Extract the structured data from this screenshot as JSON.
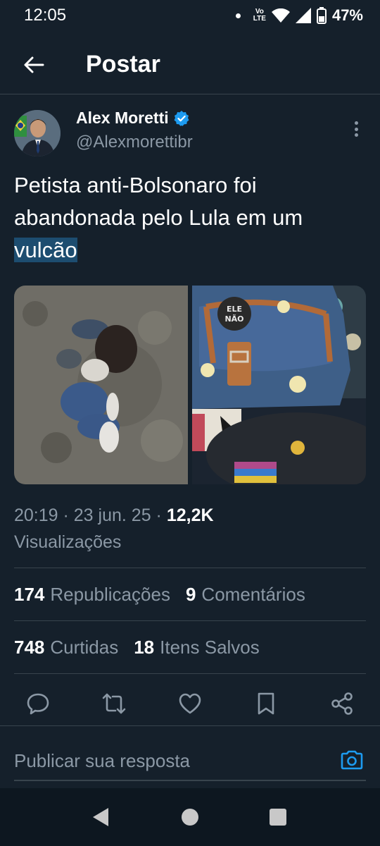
{
  "status_bar": {
    "time": "12:05",
    "network_top": "Vo",
    "network_bottom": "LTE",
    "battery": "47%"
  },
  "header": {
    "title": "Postar"
  },
  "author": {
    "name": "Alex Moretti",
    "handle": "@Alexmorettibr"
  },
  "tweet": {
    "text_before": "Petista anti-Bolsonaro foi abandonada pelo Lula em um ",
    "text_highlight": "vulcão",
    "images": [
      {
        "alt": "photo-person-curled-on-ground"
      },
      {
        "alt": "photo-backpack-with-ele-nao-button",
        "button_line1": "ELE",
        "button_line2": "NÃO"
      }
    ]
  },
  "meta": {
    "time": "20:19",
    "date": "23 jun. 25",
    "views": "12,2K",
    "views_label": "Visualizações"
  },
  "stats": {
    "reposts": "174",
    "reposts_label": "Republicações",
    "comments": "9",
    "comments_label": "Comentários",
    "likes": "748",
    "likes_label": "Curtidas",
    "saves": "18",
    "saves_label": "Itens Salvos"
  },
  "reply": {
    "placeholder": "Publicar sua resposta"
  },
  "colors": {
    "background": "#15202b",
    "accent": "#1d9bf0",
    "muted": "#8b98a5",
    "divider": "#38444d",
    "highlight": "#1d4d70"
  }
}
